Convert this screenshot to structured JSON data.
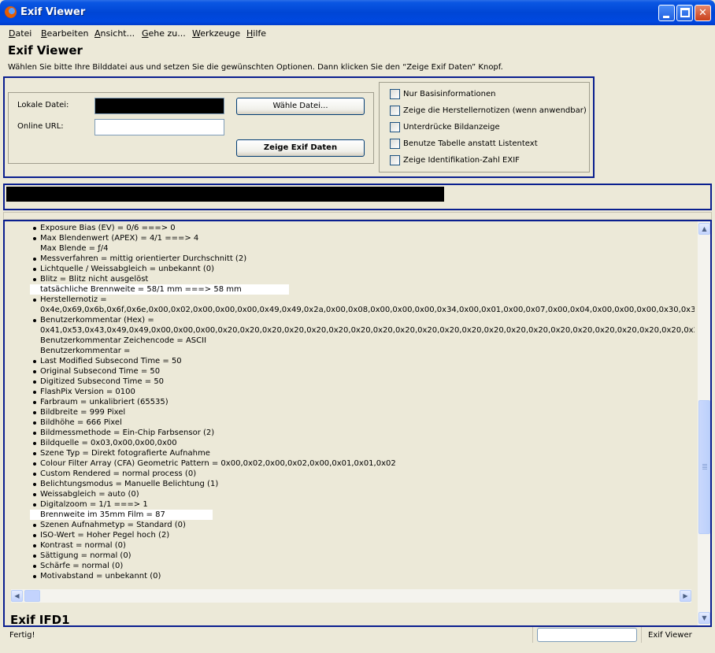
{
  "window": {
    "title": "Exif Viewer"
  },
  "menu": [
    {
      "label": "Datei",
      "u": "D",
      "rest": "atei"
    },
    {
      "label": "Bearbeiten",
      "u": "B",
      "rest": "earbeiten"
    },
    {
      "label": "Ansicht...",
      "u": "A",
      "rest": "nsicht..."
    },
    {
      "label": "Gehe zu...",
      "u": "G",
      "rest": "ehe zu..."
    },
    {
      "label": "Werkzeuge",
      "u": "W",
      "rest": "erkzeuge"
    },
    {
      "label": "Hilfe",
      "u": "H",
      "rest": "ilfe"
    }
  ],
  "page": {
    "heading": "Exif Viewer",
    "intro": "Wählen Sie bitte Ihre Bilddatei aus und setzen Sie die gewünschten Optionen. Dann klicken Sie den “Zeige Exif Daten” Knopf."
  },
  "form": {
    "local_file_label": "Lokale Datei:",
    "online_url_label": "Online URL:",
    "online_url_value": "",
    "choose_file_label": "Wähle Datei...",
    "show_exif_label": "Zeige Exif Daten"
  },
  "options": [
    "Nur Basisinformationen",
    "Zeige die Herstellernotizen (wenn anwendbar)",
    "Unterdrücke Bildanzeige",
    "Benutze Tabelle anstatt Listentext",
    "Zeige Identifikation-Zahl EXIF"
  ],
  "exif_list": [
    {
      "text": "Exposure Bias (EV) = 0/6 ===> 0",
      "bullet": true
    },
    {
      "text": "Max Blendenwert (APEX) = 4/1 ===> 4",
      "bullet": true
    },
    {
      "text": "Max Blende = ƒ/4",
      "bullet": false
    },
    {
      "text": "Messverfahren = mittig orientierter Durchschnitt (2)",
      "bullet": true
    },
    {
      "text": "Lichtquelle / Weissabgleich = unbekannt (0)",
      "bullet": true
    },
    {
      "text": "Blitz = Blitz nicht ausgelöst",
      "bullet": true
    },
    {
      "text": "tatsächliche Brennweite = 58/1 mm ===> 58 mm",
      "bullet": true,
      "selected": true
    },
    {
      "text": "Herstellernotiz =",
      "bullet": true
    },
    {
      "text": "0x4e,0x69,0x6b,0x6f,0x6e,0x00,0x02,0x00,0x00,0x00,0x49,0x49,0x2a,0x00,0x08,0x00,0x00,0x00,0x34,0x00,0x01,0x00,0x07,0x00,0x04,0x00,0x00,0x00,0x30,0x3",
      "bullet": false
    },
    {
      "text": "Benutzerkommentar (Hex) =",
      "bullet": true
    },
    {
      "text": "0x41,0x53,0x43,0x49,0x49,0x00,0x00,0x00,0x20,0x20,0x20,0x20,0x20,0x20,0x20,0x20,0x20,0x20,0x20,0x20,0x20,0x20,0x20,0x20,0x20,0x20,0x20,0x20,0x20,0x2",
      "bullet": false
    },
    {
      "text": "Benutzerkommentar Zeichencode = ASCII",
      "bullet": false
    },
    {
      "text": "Benutzerkommentar =",
      "bullet": false
    },
    {
      "text": "Last Modified Subsecond Time = 50",
      "bullet": true
    },
    {
      "text": "Original Subsecond Time = 50",
      "bullet": true
    },
    {
      "text": "Digitized Subsecond Time = 50",
      "bullet": true
    },
    {
      "text": "FlashPix Version = 0100",
      "bullet": true
    },
    {
      "text": "Farbraum = unkalibriert (65535)",
      "bullet": true
    },
    {
      "text": "Bildbreite = 999 Pixel",
      "bullet": true
    },
    {
      "text": "Bildhöhe = 666 Pixel",
      "bullet": true
    },
    {
      "text": "Bildmessmethode = Ein-Chip Farbsensor (2)",
      "bullet": true
    },
    {
      "text": "Bildquelle = 0x03,0x00,0x00,0x00",
      "bullet": true
    },
    {
      "text": "Szene Typ = Direkt fotografierte Aufnahme",
      "bullet": true
    },
    {
      "text": "Colour Filter Array (CFA) Geometric Pattern = 0x00,0x02,0x00,0x02,0x00,0x01,0x01,0x02",
      "bullet": true
    },
    {
      "text": "Custom Rendered = normal process (0)",
      "bullet": true
    },
    {
      "text": "Belichtungsmodus = Manuelle Belichtung (1)",
      "bullet": true
    },
    {
      "text": "Weissabgleich = auto (0)",
      "bullet": true
    },
    {
      "text": "Digitalzoom = 1/1 ===> 1",
      "bullet": true
    },
    {
      "text": "Brennweite im 35mm Film = 87",
      "bullet": true,
      "selected": true
    },
    {
      "text": "Szenen Aufnahmetyp = Standard (0)",
      "bullet": true
    },
    {
      "text": "ISO-Wert = Hoher Pegel hoch (2)",
      "bullet": true
    },
    {
      "text": "Kontrast = normal (0)",
      "bullet": true
    },
    {
      "text": "Sättigung = normal (0)",
      "bullet": true
    },
    {
      "text": "Schärfe = normal (0)",
      "bullet": true
    },
    {
      "text": "Motivabstand = unbekannt (0)",
      "bullet": true
    }
  ],
  "next_section_heading": "Exif IFD1",
  "status": {
    "text": "Fertig!",
    "app": "Exif Viewer"
  }
}
